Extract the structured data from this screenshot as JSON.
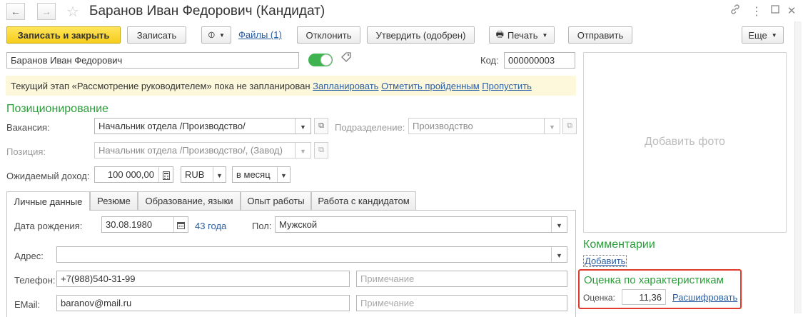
{
  "window": {
    "title": "Баранов Иван Федорович (Кандидат)",
    "nav": {
      "back": "←",
      "forward": "→"
    }
  },
  "toolbar": {
    "save_close": "Записать и закрыть",
    "save": "Записать",
    "files_link": "Файлы (1)",
    "reject": "Отклонить",
    "approve": "Утвердить (одобрен)",
    "print": "Печать",
    "send": "Отправить",
    "more": "Еще"
  },
  "candidate": {
    "name": "Баранов Иван Федорович",
    "code_label": "Код:",
    "code": "000000003",
    "active_toggle": true
  },
  "stage_notice": {
    "text": "Текущий этап «Рассмотрение руководителем» пока не запланирован",
    "plan_link": "Запланировать",
    "mark_done_link": "Отметить пройденным",
    "skip_link": "Пропустить"
  },
  "positioning": {
    "title": "Позиционирование",
    "vacancy_label": "Вакансия:",
    "vacancy": "Начальник отдела /Производство/",
    "department_label": "Подразделение:",
    "department": "Производство",
    "position_label": "Позиция:",
    "position": "Начальник отдела /Производство/, (Завод)",
    "income_label": "Ожидаемый доход:",
    "income": "100 000,00",
    "currency": "RUB",
    "period": "в месяц"
  },
  "tabs": [
    {
      "label": "Личные данные",
      "active": true
    },
    {
      "label": "Резюме",
      "active": false
    },
    {
      "label": "Образование, языки",
      "active": false
    },
    {
      "label": "Опыт работы",
      "active": false
    },
    {
      "label": "Работа с кандидатом",
      "active": false
    }
  ],
  "personal": {
    "birth_label": "Дата рождения:",
    "birth_date": "30.08.1980",
    "age_link": "43 года",
    "gender_label": "Пол:",
    "gender": "Мужской",
    "address_label": "Адрес:",
    "address": "",
    "phone_label": "Телефон:",
    "phone": "+7(988)540-31-99",
    "phone_note_placeholder": "Примечание",
    "email_label": "EMail:",
    "email": "baranov@mail.ru",
    "email_note_placeholder": "Примечание"
  },
  "photo": {
    "placeholder": "Добавить фото"
  },
  "comments": {
    "title": "Комментарии",
    "add_link": "Добавить"
  },
  "rating": {
    "title": "Оценка по характеристикам",
    "score_label": "Оценка:",
    "score": "11,36",
    "decode_link": "Расшифровать"
  },
  "colors": {
    "accent_green": "#2a9d3a",
    "link_blue": "#2a5ea4",
    "primary_yellow": "#f5cd1d",
    "notice_bg": "#fdf8dc",
    "highlight_red": "#e03a2f",
    "toggle_green": "#3fb34f"
  },
  "icons": {
    "back": "arrow-left-icon",
    "forward": "arrow-right-icon",
    "favorite": "star-icon",
    "link": "link-icon",
    "menu": "more-vert-icon",
    "maximize": "maximize-icon",
    "close": "close-icon",
    "attach": "paperclip-icon",
    "print": "printer-icon",
    "calculator": "calculator-icon",
    "calendar": "calendar-icon",
    "tag": "tag-icon"
  }
}
